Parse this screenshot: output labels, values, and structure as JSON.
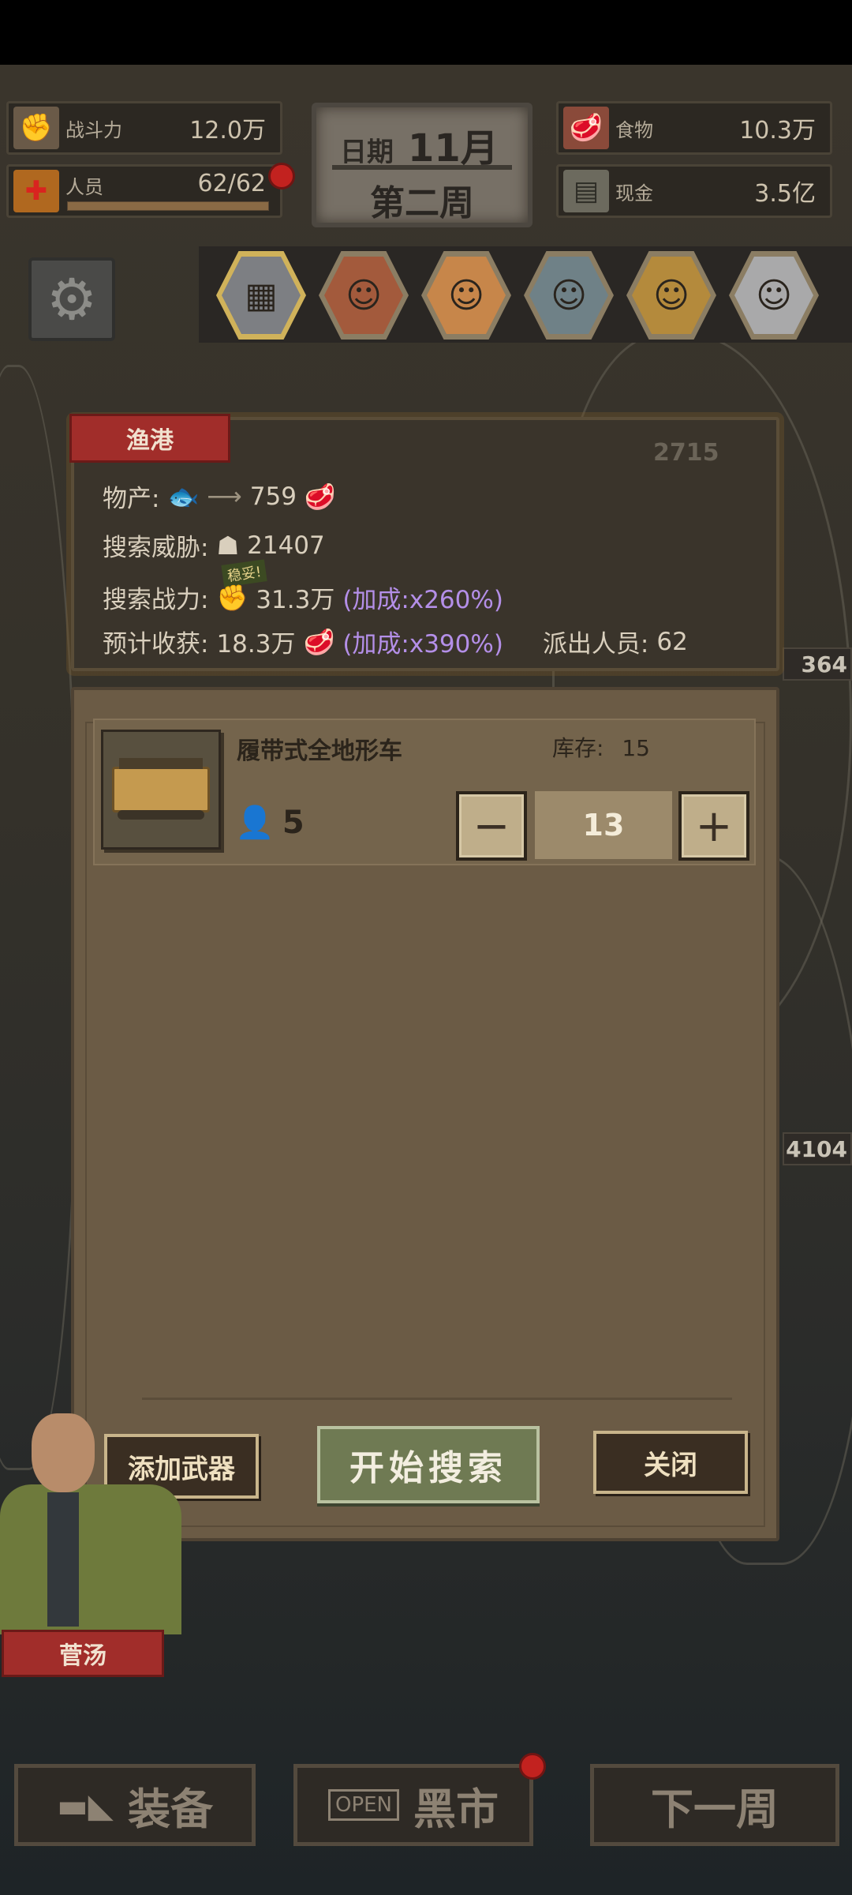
{
  "hud": {
    "combat": {
      "icon": "fist-icon",
      "label": "战斗力",
      "value": "12.0万"
    },
    "staff": {
      "icon": "cross-icon",
      "label": "人员",
      "value": "62/62",
      "fill": 1.0
    },
    "date": {
      "label": "日期",
      "month": "11月",
      "week": "第二周"
    },
    "food": {
      "icon": "meat-icon",
      "label": "食物",
      "value": "10.3万"
    },
    "cash": {
      "icon": "cash-icon",
      "label": "现金",
      "value": "3.5亿"
    }
  },
  "map_badges": [
    "2715",
    "364",
    "4104"
  ],
  "modal": {
    "title": "渔港",
    "produce_label": "物产:",
    "produce_value": "759",
    "threat_label": "搜索威胁:",
    "threat_value": "21407",
    "power_label": "搜索战力:",
    "power_value": "31.3万",
    "power_bonus": "(加成:x260%)",
    "safe_tag": "稳妥!",
    "harvest_label": "预计收获:",
    "harvest_value": "18.3万",
    "harvest_bonus": "(加成:x390%)",
    "dispatch_label": "派出人员:",
    "dispatch_value": "62"
  },
  "item": {
    "name": "履带式全地形车",
    "stock_label": "库存:",
    "stock_value": "15",
    "crew": "5",
    "quantity": "13"
  },
  "buttons": {
    "add_weapon": "添加武器",
    "start_search": "开始搜索",
    "close": "关闭"
  },
  "character_tag": "菅汤",
  "bottom": {
    "equip": "装备",
    "market_sign": "OPEN",
    "market": "黑市",
    "next_week": "下一周"
  },
  "colors": {
    "accent_red": "#a12d2a",
    "bonus_purple": "#b48fe8",
    "start_green": "#6f7a53"
  }
}
